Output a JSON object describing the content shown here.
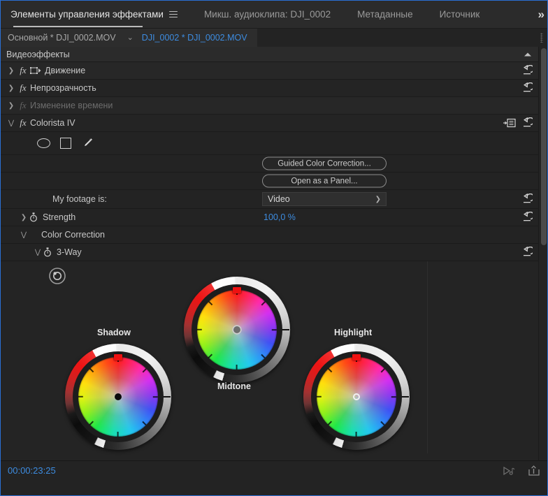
{
  "window": {
    "accent_blue": "#3d8ce0",
    "panel_bg": "#232323"
  },
  "tabs": [
    {
      "label": "Элементы управления эффектами",
      "active": true,
      "has_menu": true
    },
    {
      "label": "Микш. аудиоклипа: DJI_0002",
      "active": false
    },
    {
      "label": "Метаданные",
      "active": false
    },
    {
      "label": "Источник",
      "active": false
    }
  ],
  "tabbar": {
    "overflow_icon": "chevron-double-right-icon",
    "overflow_label": "»"
  },
  "clip_selector": {
    "sequence": "Основной * DJI_0002.MOV",
    "caret": "⌄",
    "clip": "DJI_0002 * DJI_0002.MOV"
  },
  "effects": {
    "group_header": "Видеоэффекты",
    "items": [
      {
        "label": "Движение",
        "expanded": false,
        "fx": "fx",
        "disabled": false,
        "has_reset": true,
        "has_motion_icon": true
      },
      {
        "label": "Непрозрачность",
        "expanded": false,
        "fx": "fx",
        "disabled": false,
        "has_reset": true,
        "has_motion_icon": false
      },
      {
        "label": "Изменение времени",
        "expanded": false,
        "fx": "fx",
        "disabled": true,
        "has_reset": false,
        "has_motion_icon": false
      },
      {
        "label": "Colorista IV",
        "expanded": true,
        "fx": "fx",
        "disabled": false,
        "has_reset": true,
        "has_link": true,
        "has_motion_icon": false
      }
    ]
  },
  "mask_tools": [
    {
      "name": "ellipse-mask-tool"
    },
    {
      "name": "rectangle-mask-tool"
    },
    {
      "name": "pen-mask-tool"
    }
  ],
  "colorista": {
    "guided_button": "Guided Color Correction...",
    "panel_button": "Open as a Panel...",
    "footage_label": "My footage is:",
    "footage_value": "Video",
    "footage_options": [
      "Video"
    ],
    "strength_label": "Strength",
    "strength_value": "100,0 %",
    "color_correction_label": "Color Correction",
    "three_way_label": "3-Way"
  },
  "color_wheels": [
    {
      "name": "Shadow",
      "label": "Shadow",
      "handle": "solid-black"
    },
    {
      "name": "Midtone",
      "label": "Midtone",
      "handle": "grey-ring"
    },
    {
      "name": "Highlight",
      "label": "Highlight",
      "handle": "open-ring"
    }
  ],
  "bottom_bar": {
    "timecode": "00:00:23:25",
    "icons": [
      {
        "name": "play-audio-icon"
      },
      {
        "name": "export-frame-icon"
      }
    ]
  }
}
